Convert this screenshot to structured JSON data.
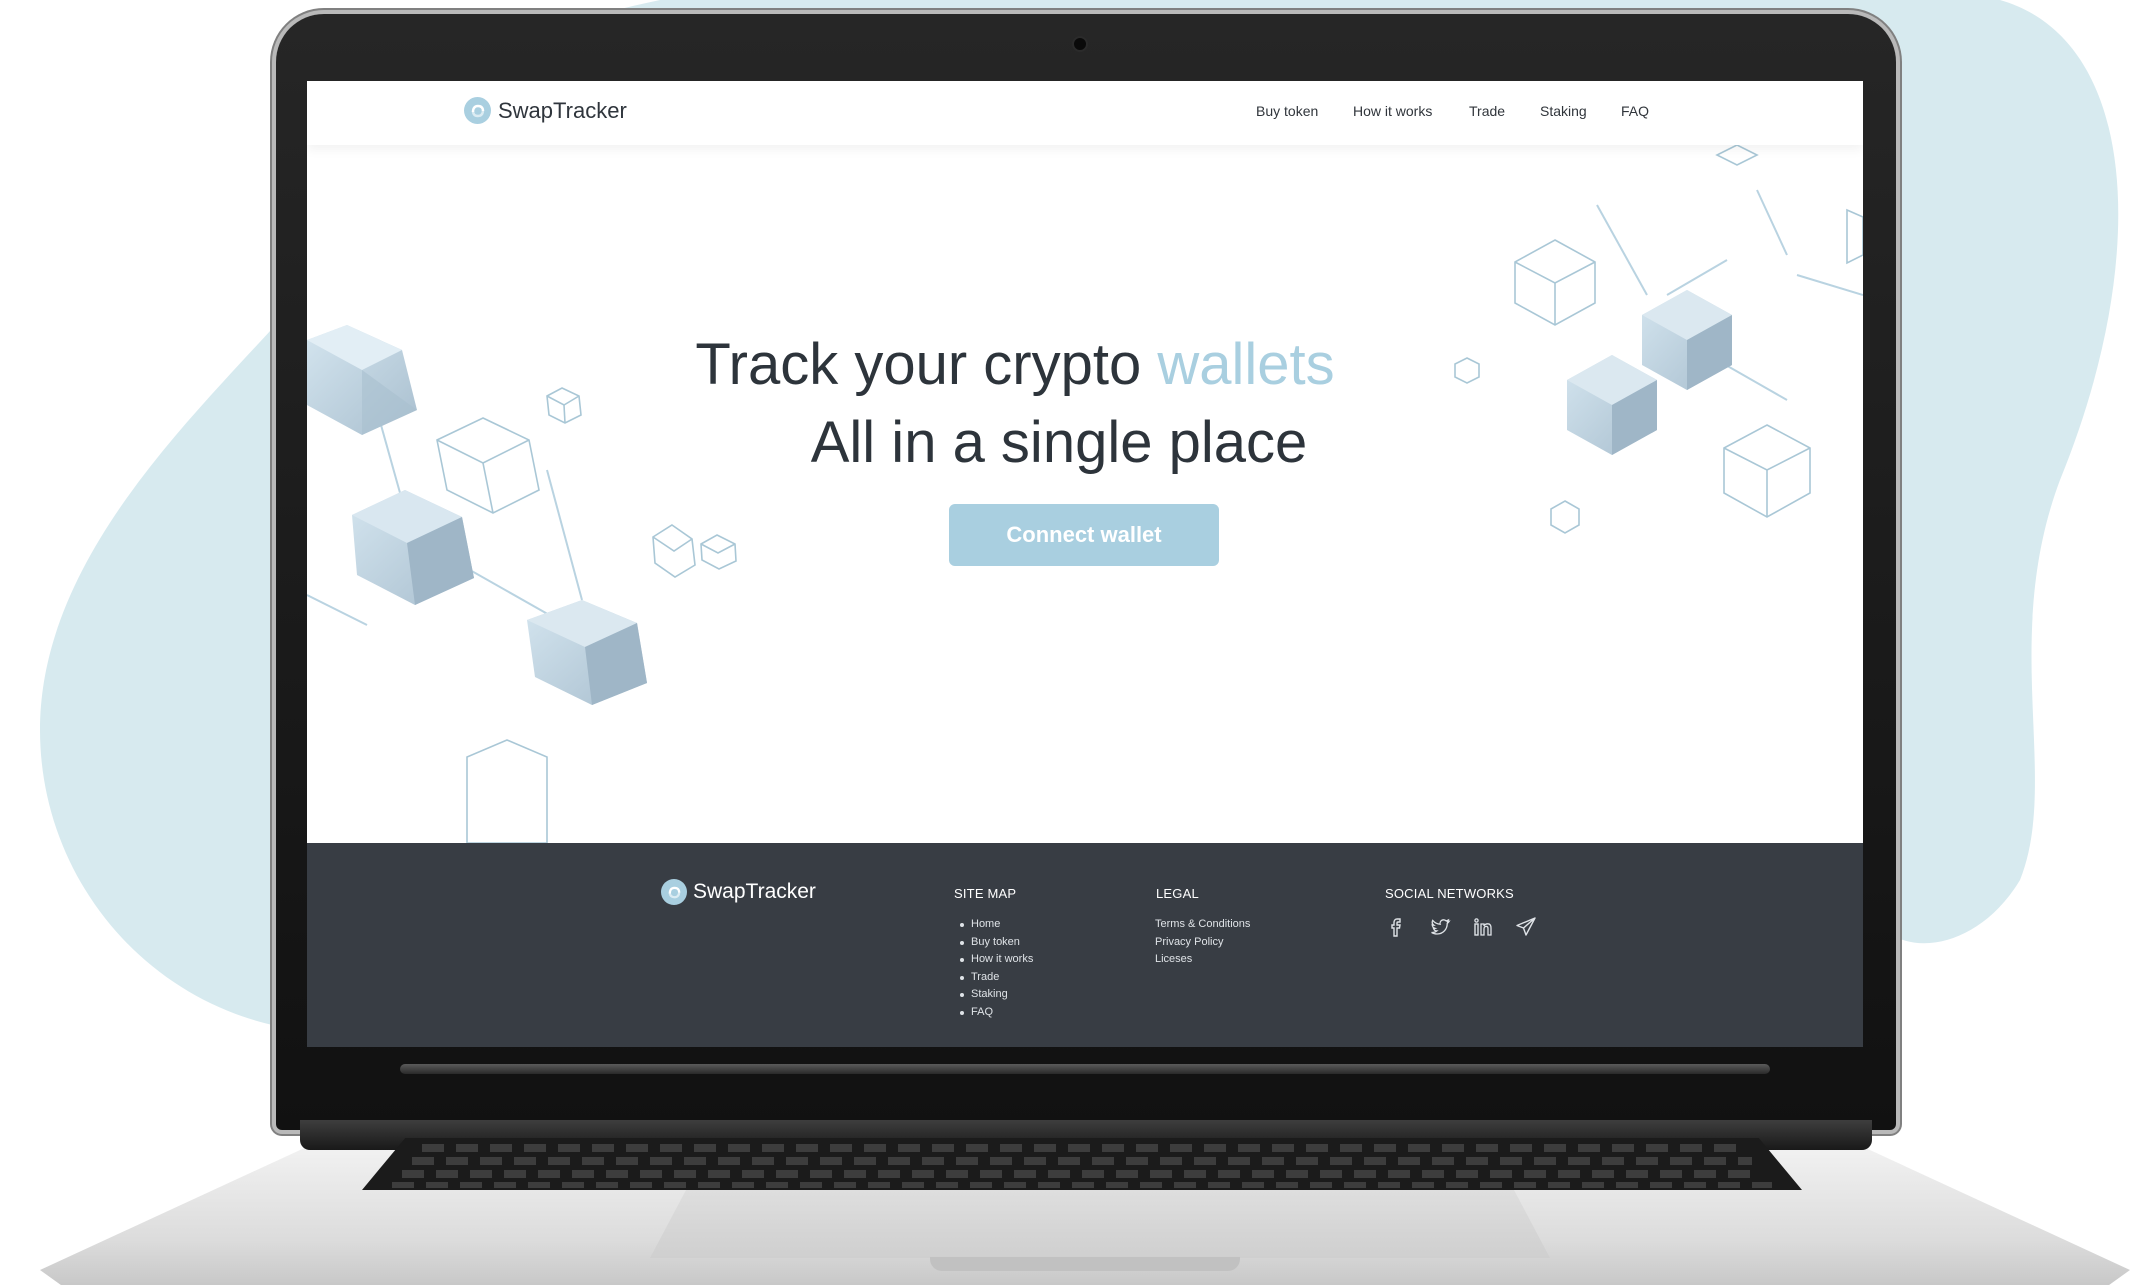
{
  "colors": {
    "accent": "#a9cfe0",
    "dark": "#2d343b",
    "footer_bg": "#383d44",
    "blob": "#d7eaef"
  },
  "brand": {
    "name": "SwapTracker",
    "logo_icon": "swap-logo-icon"
  },
  "nav": {
    "items": [
      {
        "label": "Buy token"
      },
      {
        "label": "How it works"
      },
      {
        "label": "Trade"
      },
      {
        "label": "Staking"
      },
      {
        "label": "FAQ"
      }
    ]
  },
  "hero": {
    "line1_text": "Track your crypto",
    "line1_accent": "wallets",
    "line2": "All in a single place",
    "cta_label": "Connect wallet"
  },
  "footer": {
    "brand": "SwapTracker",
    "sitemap": {
      "heading": "SITE MAP",
      "items": [
        "Home",
        "Buy token",
        "How it works",
        "Trade",
        "Staking",
        "FAQ"
      ]
    },
    "legal": {
      "heading": "LEGAL",
      "items": [
        "Terms & Conditions",
        "Privacy Policy",
        "Liceses"
      ]
    },
    "social": {
      "heading": "SOCIAL NETWORKS",
      "icons": [
        "facebook-icon",
        "twitter-icon",
        "linkedin-icon",
        "telegram-icon"
      ]
    }
  }
}
